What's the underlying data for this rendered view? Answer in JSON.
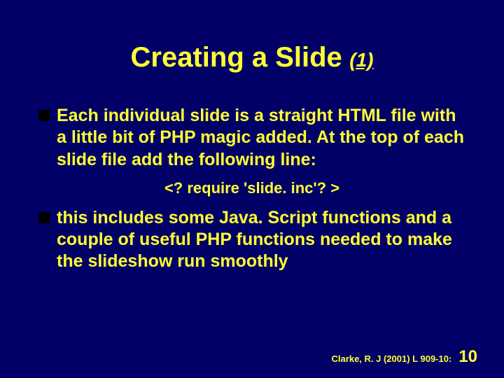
{
  "title": {
    "main": "Creating a Slide",
    "sub": "(1)"
  },
  "bullets": [
    {
      "text": "Each individual slide is a straight HTML file with a little bit of PHP magic added. At the top of each slide file add the following line:"
    },
    {
      "text": "this includes some Java. Script functions and a couple of useful PHP functions needed to make the slideshow run smoothly"
    }
  ],
  "code_line": "<? require 'slide. inc'? >",
  "footer": {
    "citation": "Clarke, R. J (2001) L 909-10:",
    "page": "10"
  }
}
